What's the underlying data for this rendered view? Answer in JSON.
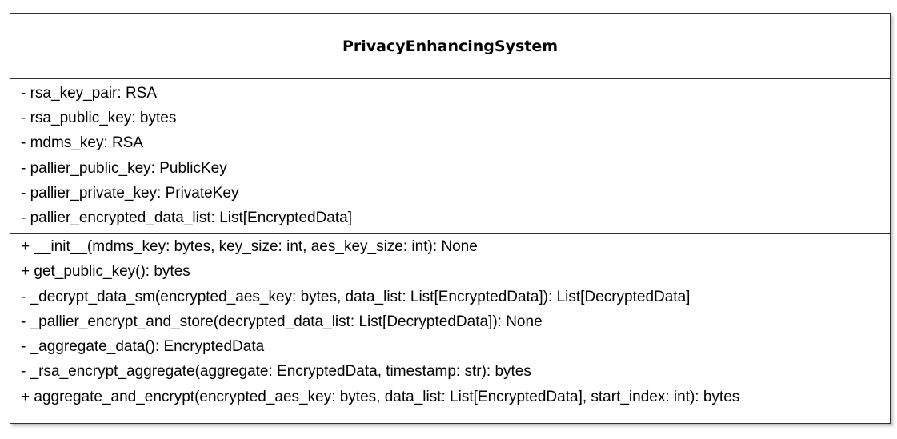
{
  "class": {
    "name": "PrivacyEnhancingSystem",
    "attributes": [
      "- rsa_key_pair: RSA",
      "- rsa_public_key: bytes",
      "- mdms_key: RSA",
      "- pallier_public_key: PublicKey",
      "- pallier_private_key: PrivateKey",
      "- pallier_encrypted_data_list: List[EncryptedData]"
    ],
    "operations": [
      "+ __init__(mdms_key: bytes, key_size: int, aes_key_size: int): None",
      "+ get_public_key(): bytes",
      "- _decrypt_data_sm(encrypted_aes_key: bytes, data_list: List[EncryptedData]): List[DecryptedData]",
      "- _pallier_encrypt_and_store(decrypted_data_list: List[DecryptedData]): None",
      "- _aggregate_data(): EncryptedData",
      "- _rsa_encrypt_aggregate(aggregate: EncryptedData, timestamp: str): bytes",
      "+ aggregate_and_encrypt(encrypted_aes_key: bytes, data_list: List[EncryptedData], start_index: int): bytes"
    ]
  }
}
